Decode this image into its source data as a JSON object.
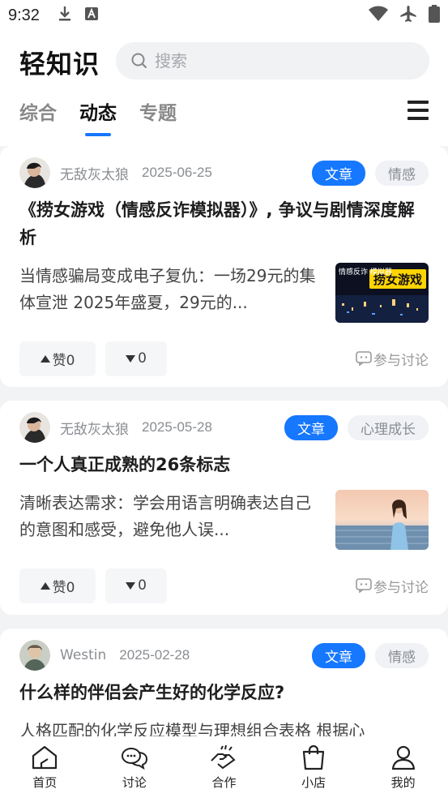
{
  "status_bar": {
    "time": "9:32",
    "left_icons": [
      "download-icon",
      "font-icon"
    ],
    "right_icons": [
      "wifi-icon",
      "airplane-icon",
      "battery-icon"
    ]
  },
  "header": {
    "app_title": "轻知识",
    "search_placeholder": "搜索",
    "tabs": [
      {
        "label": "综合",
        "active": false
      },
      {
        "label": "动态",
        "active": true
      },
      {
        "label": "专题",
        "active": false
      }
    ]
  },
  "accent_color": "#1677ff",
  "posts": [
    {
      "author": "无敌灰太狼",
      "date": "2025-06-25",
      "type_tag": "文章",
      "category_tag": "情感",
      "title": "《捞女游戏（情感反诈模拟器）》, 争议与剧情深度解析",
      "summary": "当情感骗局变成电子复仇：一场29元的集体宣泄 2025年盛夏，29元的...",
      "thumb_text": "捞女游戏",
      "thumb_small_text": "情感反诈 模拟器",
      "likes_label": "赞0",
      "dislikes": "0",
      "discuss_label": "参与讨论"
    },
    {
      "author": "无敌灰太狼",
      "date": "2025-05-28",
      "type_tag": "文章",
      "category_tag": "心理成长",
      "title": "一个人真正成熟的26条标志",
      "summary": "清晰表达需求：学会用语言明确表达自己的意图和感受，避免他人误...",
      "likes_label": "赞0",
      "dislikes": "0",
      "discuss_label": "参与讨论"
    },
    {
      "author": "Westin",
      "date": "2025-02-28",
      "type_tag": "文章",
      "category_tag": "情感",
      "title": "什么样的伴侣会产生好的化学反应?",
      "summary": "人格匹配的化学反应模型与理想组合表格 根据心"
    }
  ],
  "bottom_nav": [
    {
      "label": "首页",
      "icon": "home-icon"
    },
    {
      "label": "讨论",
      "icon": "chat-icon"
    },
    {
      "label": "合作",
      "icon": "handshake-icon"
    },
    {
      "label": "小店",
      "icon": "shopping-bag-icon"
    },
    {
      "label": "我的",
      "icon": "user-icon"
    }
  ]
}
